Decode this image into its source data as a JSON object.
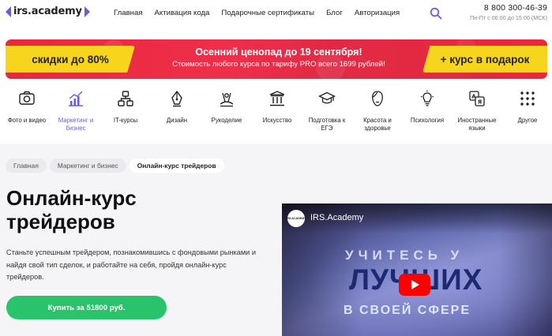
{
  "header": {
    "logo_text": "irs.academy",
    "nav": [
      "Главная",
      "Активация кода",
      "Подарочные сертификаты",
      "Блог",
      "Авторизация"
    ],
    "phone": "8 800 300-46-39",
    "hours": "Пн-Пт с 06:00 до 15:00 (МСК)"
  },
  "banner": {
    "left": "скидки до 80%",
    "title": "Осенний ценопад до 19 сентября!",
    "subtitle": "Стоимость любого курса по тарифу PRO всего 1699 рублей!",
    "right": "+ курс в подарок"
  },
  "categories": [
    {
      "label": "Фото и видео",
      "icon": "camera-icon"
    },
    {
      "label": "Маркетинг и бизнес",
      "icon": "chart-icon",
      "active": true
    },
    {
      "label": "IT-курсы",
      "icon": "network-icon"
    },
    {
      "label": "Дизайн",
      "icon": "pen-nib-icon"
    },
    {
      "label": "Рукоделие",
      "icon": "crafts-icon"
    },
    {
      "label": "Искусство",
      "icon": "column-icon"
    },
    {
      "label": "Подготовка к ЕГЭ",
      "icon": "graduation-cap-icon"
    },
    {
      "label": "Красота и здоровье",
      "icon": "face-icon"
    },
    {
      "label": "Психология",
      "icon": "lightbulb-icon"
    },
    {
      "label": "Иностранные языки",
      "icon": "translate-icon"
    },
    {
      "label": "Другое",
      "icon": "grid-dots-icon"
    }
  ],
  "breadcrumbs": [
    "Главная",
    "Маркетинг и бизнес",
    "Онлайн-курс трейдеров"
  ],
  "course": {
    "title_line1": "Онлайн-курс",
    "title_line2": "трейдеров",
    "description": "Станьте успешным трейдером, познакомившись с фондовыми рынками и найдя свой тип сделок, и работайте на себя, пройдя онлайн-курс трейдеров.",
    "buy_label": "Купить за 51800 руб."
  },
  "video": {
    "channel": "IRS.Academy",
    "channel_badge": "IRS.ACADEMY",
    "line1": "УЧИТЕСЬ У",
    "line2": "ЛУЧШИХ",
    "line3": "В СВОЕЙ СФЕРЕ"
  },
  "colors": {
    "accent": "#6a5ce0",
    "banner_red": "#e8283c",
    "banner_yellow": "#f7d51d",
    "buy_green": "#28c36a"
  }
}
